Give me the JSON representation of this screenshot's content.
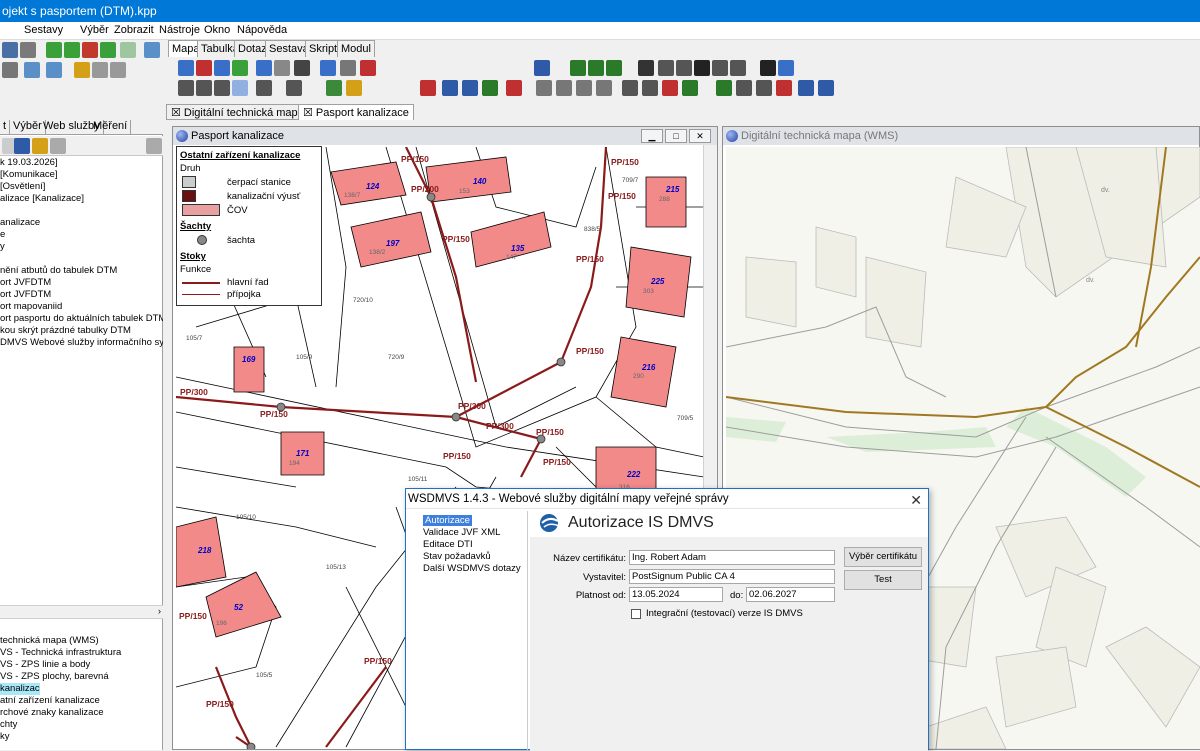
{
  "window": {
    "title": "ojekt s pasportem (DTM).kpp"
  },
  "menu": {
    "items": [
      "Sestavy",
      "Výběr",
      "Zobrazit",
      "Nástroje",
      "Okno",
      "Nápověda"
    ]
  },
  "module_tabs": [
    "Mapa",
    "Tabulka",
    "Dotaz",
    "Sestava",
    "Skript",
    "Modul"
  ],
  "doc_tabs": [
    "Digitální technická mapa (WMS)",
    "Pasport kanalizace"
  ],
  "left_panel": {
    "tabs": [
      "t",
      "Výběr",
      "Web služby",
      "Měření"
    ],
    "items": [
      "k 19.03.2026]",
      "[Komunikace]",
      "[Osvětlení]",
      "alizace [Kanalizace]",
      "",
      "analizace",
      "e",
      "y",
      "",
      "nění atbutů do tabulek DTM",
      "ort JVFDTM",
      "ort JVFDTM",
      "ort mapovaniid",
      "ort pasportu do aktuálních tabulek DTM",
      "kou skrýt prázdné tabulky DTM",
      "DMVS Webové služby informačního systému"
    ],
    "layers": [
      "technická mapa (WMS)",
      "VS - Technická infrastruktura",
      "VS - ZPS linie a body",
      "VS - ZPS plochy, barevná",
      "kanalizace",
      "atní zařízení kanalizace",
      "rchové znaky kanalizace",
      "chty",
      "ky"
    ],
    "selected_layer_index": 4
  },
  "map_left": {
    "title": "Pasport kanalizace",
    "legend": {
      "title": "Ostatní zařízení kanalizace",
      "druh": "Druh",
      "items": [
        "čerpací stanice",
        "kanalizační výusť",
        "ČOV"
      ],
      "sachty_title": "Šachty",
      "sachty_item": "šachta",
      "stoky_title": "Stoky",
      "funkce": "Funkce",
      "stoky_items": [
        "hlavní řad",
        "přípojka"
      ]
    },
    "pipe_labels": [
      "PP/150",
      "PP/200",
      "PP/150",
      "PP/150",
      "PP/150",
      "PP/150",
      "PP/300",
      "PP/150",
      "PP/300",
      "PP/300",
      "PP/150",
      "PP/150",
      "PP/150",
      "PP/150",
      "PP/150",
      "PP/150",
      "PP/150"
    ],
    "parcels": [
      "124",
      "140",
      "197",
      "135",
      "215",
      "225",
      "216",
      "169",
      "171",
      "222",
      "218",
      "52"
    ],
    "parcel_sublabels": [
      "138/7",
      "153",
      "138/2",
      "147",
      "288",
      "303",
      "290",
      "194",
      "316",
      "196"
    ],
    "lot_labels": [
      "720/10",
      "105/7",
      "105/9",
      "720/9",
      "709/5",
      "105/11",
      "105/10",
      "105/13",
      "105/5",
      "838/5",
      "709/7"
    ]
  },
  "map_right": {
    "title": "Digitální technická mapa (WMS)",
    "lot_labels": [
      "dv.",
      "dv."
    ]
  },
  "dialog": {
    "title": "WSDMVS 1.4.3 - Webové služby digitální mapy veřejné správy",
    "tree": [
      "Autorizace",
      "Validace JVF XML",
      "Editace DTI",
      "Stav požadavků",
      "Další WSDMVS dotazy"
    ],
    "heading": "Autorizace IS DMVS",
    "cert_label": "Název certifikátu:",
    "cert_value": "Ing. Robert Adam",
    "issuer_label": "Vystavitel:",
    "issuer_value": "PostSignum Public CA 4",
    "valid_label": "Platnost od:",
    "valid_from": "13.05.2024",
    "valid_to_label": "do:",
    "valid_to": "02.06.2027",
    "checkbox_label": "Integrační (testovací) verze IS DMVS",
    "btn_select": "Výběr certifikátu",
    "btn_test": "Test"
  },
  "colors": {
    "accent": "#0078d7",
    "pipe": "#8b1a1a",
    "parcel": "#f28a8a",
    "wms_pipe": "#a07820"
  }
}
